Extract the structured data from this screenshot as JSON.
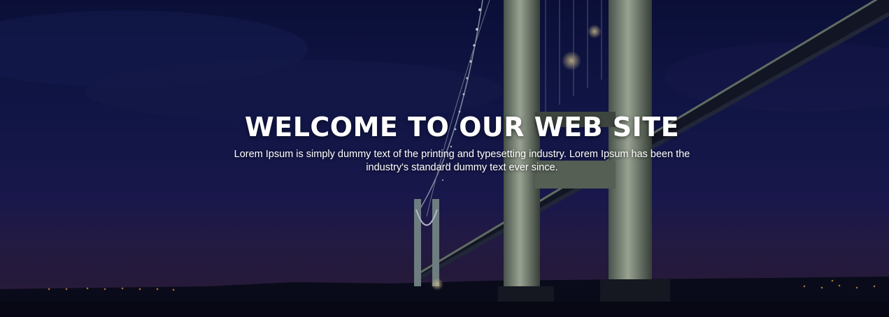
{
  "hero": {
    "title": "WELCOME TO OUR WEB SITE",
    "subtitle": "Lorem Ipsum is simply dummy text of the printing and typesetting industry. Lorem Ipsum has been the industry's standard dummy text ever since.",
    "background_image": "night-suspension-bridge",
    "colors": {
      "sky_top": "#0c1240",
      "sky_mid": "#1f1d5a",
      "text": "#ffffff"
    }
  }
}
